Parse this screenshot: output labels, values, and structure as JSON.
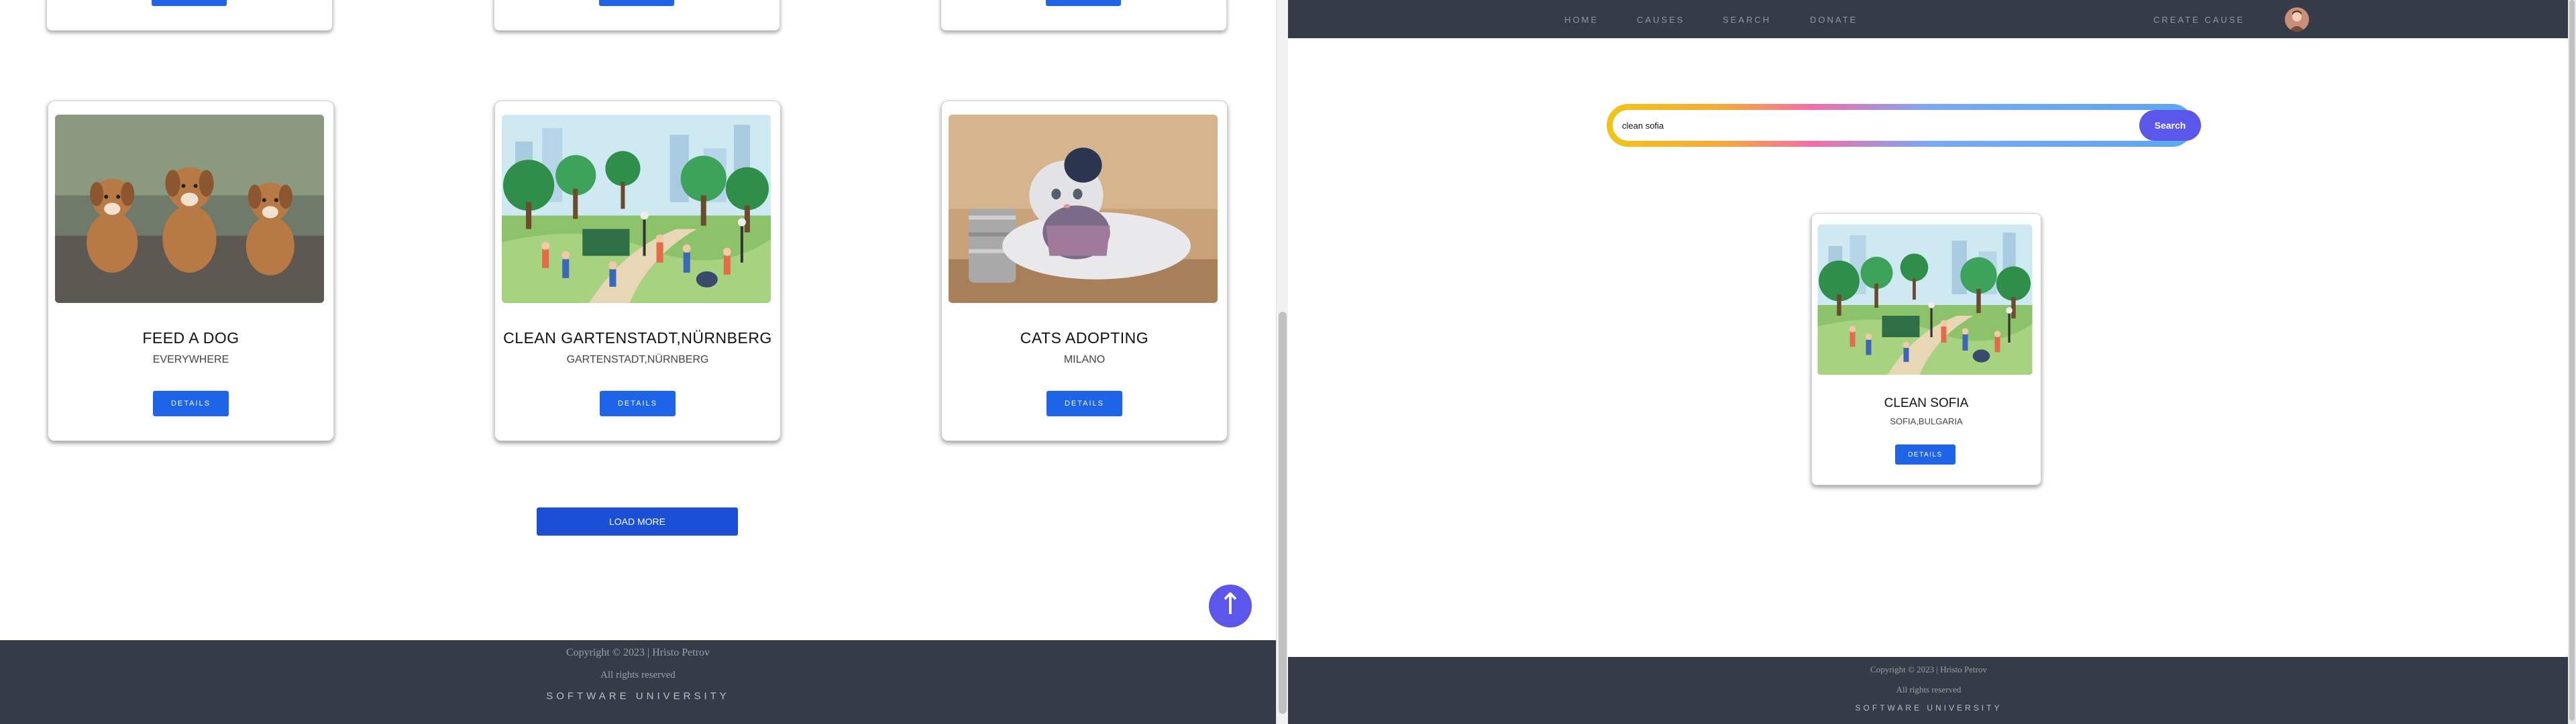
{
  "left_window": {
    "cards": [
      {
        "title": "FEED A DOG",
        "location": "EVERYWHERE",
        "button": "DETAILS",
        "image": "puppies-photo"
      },
      {
        "title": "CLEAN GARTENSTADT,NÜRNBERG",
        "location": "GARTENSTADT,NÜRNBERG",
        "button": "DETAILS",
        "image": "park-cleanup-illustration"
      },
      {
        "title": "CATS ADOPTING",
        "location": "MILANO",
        "button": "DETAILS",
        "image": "cat-with-can-photo"
      }
    ],
    "load_more": "LOAD MORE",
    "scroll_top_icon": "↑",
    "footer": {
      "copyright": "Copyright © 2023 | Hristo Petrov",
      "rights": "All rights reserved",
      "brand": "SOFTWARE UNIVERSITY"
    }
  },
  "right_window": {
    "nav": {
      "home": "HOME",
      "causes": "CAUSES",
      "search": "SEARCH",
      "donate": "DONATE",
      "create_cause": "CREATE CAUSE"
    },
    "search": {
      "value": "clean sofia",
      "button": "Search"
    },
    "result_card": {
      "title": "CLEAN SOFIA",
      "location": "SOFIA,BULGARIA",
      "button": "DETAILS",
      "image": "park-cleanup-illustration"
    },
    "footer": {
      "copyright": "Copyright © 2023 | Hristo Petrov",
      "rights": "All rights reserved",
      "brand": "SOFTWARE UNIVERSITY"
    }
  },
  "colors": {
    "nav_bg": "#353c47",
    "primary_button": "#1d64e8",
    "accent_purple": "#5b57ea"
  }
}
